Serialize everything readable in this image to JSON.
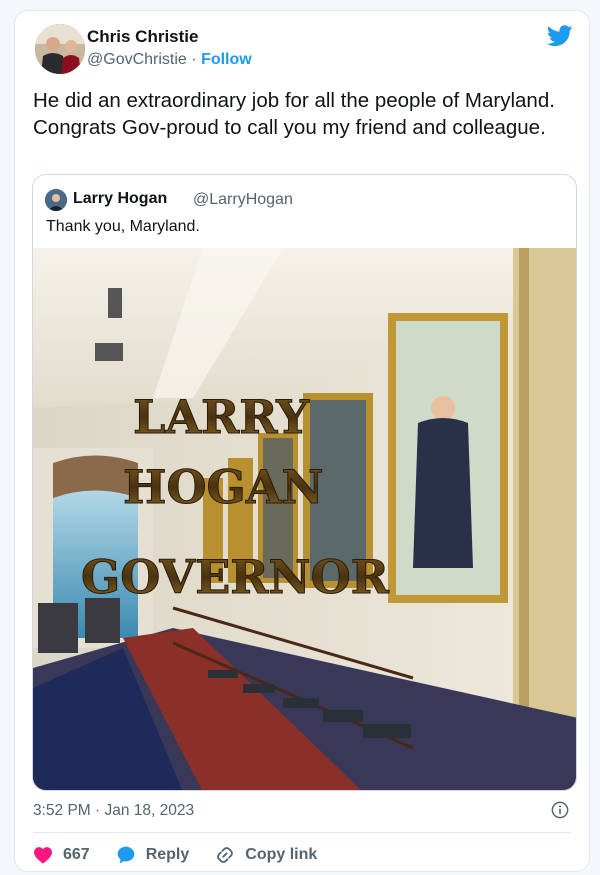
{
  "author": {
    "name": "Chris Christie",
    "handle": "@GovChristie",
    "separator": "·",
    "follow_label": "Follow"
  },
  "tweet_text": "He did an extraordinary job for all the people of Maryland. Congrats Gov-proud to call you my friend and colleague.",
  "quoted": {
    "name": "Larry Hogan",
    "handle": "@LarryHogan",
    "text": "Thank you, Maryland.",
    "image_overlay": [
      "LARRY",
      "HOGAN",
      "GOVERNOR"
    ]
  },
  "timestamp": "3:52 PM · Jan 18, 2023",
  "actions": {
    "like_count": "667",
    "reply_label": "Reply",
    "copy_label": "Copy link"
  },
  "colors": {
    "twitter_blue": "#1d9bf0",
    "like_red": "#f91880",
    "text_gray": "#536471"
  },
  "icons": [
    "twitter-bird-icon",
    "info-icon",
    "heart-icon",
    "reply-bubble-icon",
    "link-icon"
  ]
}
